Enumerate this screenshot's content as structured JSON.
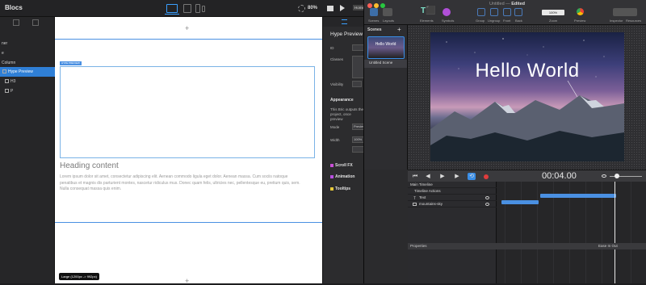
{
  "blocs": {
    "title": "Blocs",
    "zoom": "80%",
    "home_label": "Home",
    "tree": [
      "ner",
      "e",
      "Column",
      "Hype Preview",
      "H3",
      "P"
    ],
    "canvas": {
      "preview_tag": "HYPE PREVIEW",
      "heading": "Heading content",
      "paragraph": "Lorem ipsum dolor sit amet, consectetur adipiscing elit. Aenean commodo ligula eget dolor. Aenean massa. Cum sociis natoque penatibus et magnis dis parturient montes, nascetur ridiculus mus. Donec quam felis, ultricies nec, pellentesque eu, pretium quis, sem. Nulla consequat massa quis enim.",
      "breakpoint": "Large (1200px -> 992px)",
      "plus": "+"
    },
    "inspector": {
      "title": "Hype Preview",
      "id_label": "ID",
      "classes_label": "Classes",
      "visibility_label": "Visibility",
      "appearance_label": "Appearance",
      "desc": "This Bric outputs the project, once preview",
      "mode_label": "Mode",
      "mode_value": "Preview",
      "width_label": "Width",
      "width_value": "100%",
      "sections": [
        {
          "label": "Scroll FX",
          "color": "#c94fd6"
        },
        {
          "label": "Animation",
          "color": "#b84fe0"
        },
        {
          "label": "Tooltips",
          "color": "#e6c93a"
        }
      ]
    }
  },
  "hype": {
    "title": "Untitled",
    "title_state": "Edited",
    "toolbar": {
      "scenes": "Scenes",
      "layouts": "Layouts",
      "elements": "Elements",
      "symbols": "Symbols",
      "group": "Group",
      "ungroup": "Ungroup",
      "front": "Front",
      "back": "Back",
      "zoom_value": "100%",
      "zoom_label": "Zoom",
      "preview": "Preview",
      "inspector": "Inspector",
      "resources": "Resources"
    },
    "scenes_header": "Scenes",
    "scene_name": "Untitled Scene",
    "scene_thumb_text": "Hello World",
    "stage_text": "Hello World",
    "time": "00:04.00",
    "timeline": {
      "main": "Main Timeline",
      "actions": "Timeline Actions",
      "rows": [
        "Text",
        "mountains-sky"
      ]
    },
    "properties": "Properties",
    "ease": "Ease In Out"
  }
}
